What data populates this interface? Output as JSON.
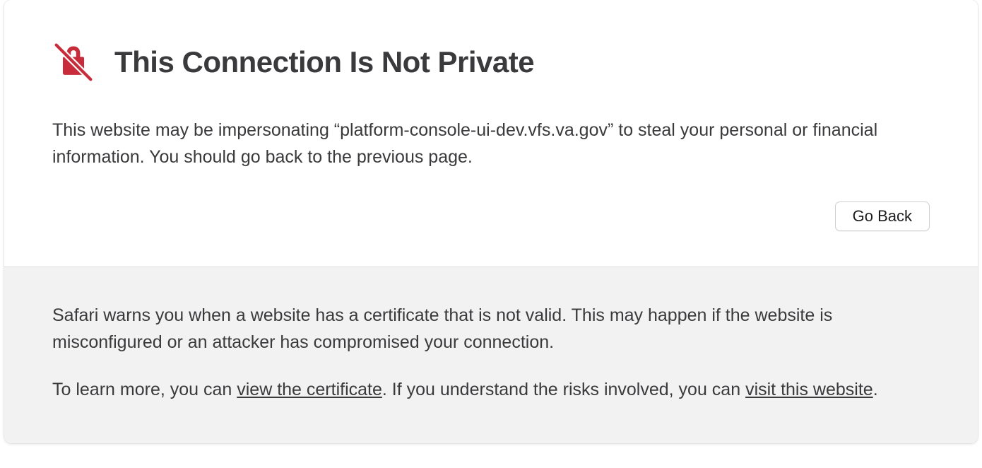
{
  "warning": {
    "title": "This Connection Is Not Private",
    "message_prefix": "This website may be impersonating “",
    "domain": "platform-console-ui-dev.vfs.va.gov",
    "message_suffix": "” to steal your personal or financial information. You should go back to the previous page.",
    "go_back_label": "Go Back"
  },
  "details": {
    "paragraph1": "Safari warns you when a website has a certificate that is not valid. This may happen if the website is misconfigured or an attacker has compromised your connection.",
    "paragraph2_part1": "To learn more, you can ",
    "link1": "view the certificate",
    "paragraph2_part2": ". If you understand the risks involved, you can ",
    "link2": "visit this website",
    "paragraph2_part3": "."
  },
  "colors": {
    "warning_icon": "#c82b3a",
    "text": "#3a3a3c",
    "bottom_bg": "#f2f2f2"
  }
}
